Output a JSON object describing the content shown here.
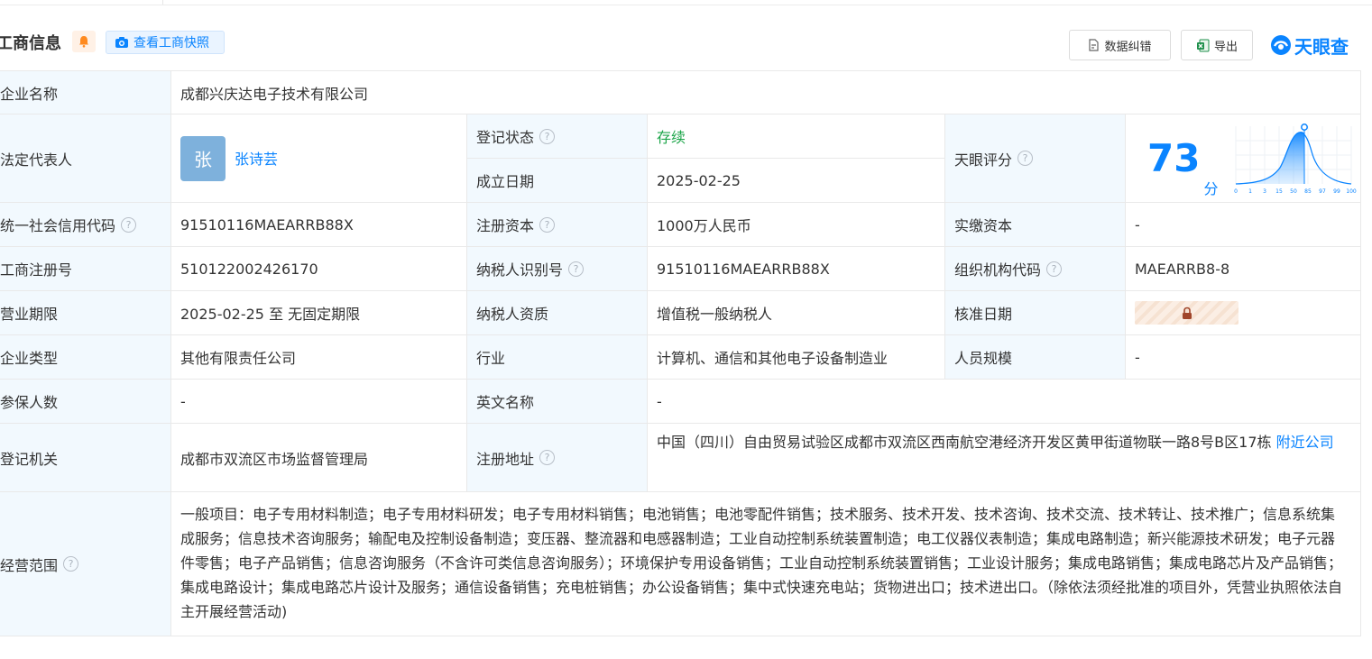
{
  "header": {
    "title": "工商信息",
    "snapshot_label": "查看工商快照",
    "correct_label": "数据纠错",
    "export_label": "导出",
    "logo_text": "天眼查"
  },
  "company": {
    "name_label": "企业名称",
    "name": "成都兴庆达电子技术有限公司",
    "legal_rep_label": "法定代表人",
    "avatar_char": "张",
    "legal_rep": "张诗芸",
    "status_label": "登记状态",
    "status": "存续",
    "founded_label": "成立日期",
    "founded": "2025-02-25",
    "score_label": "天眼评分",
    "score": "73",
    "score_unit": "分",
    "score_axis": [
      "0",
      "1",
      "3",
      "15",
      "50",
      "85",
      "97",
      "99",
      "100"
    ],
    "credit_code_label": "统一社会信用代码",
    "credit_code": "91510116MAEARRB88X",
    "reg_capital_label": "注册资本",
    "reg_capital": "1000万人民币",
    "paid_capital_label": "实缴资本",
    "paid_capital": "-",
    "reg_no_label": "工商注册号",
    "reg_no": "510122002426170",
    "taxpayer_id_label": "纳税人识别号",
    "taxpayer_id": "91510116MAEARRB88X",
    "org_code_label": "组织机构代码",
    "org_code": "MAEARRB8-8",
    "term_label": "营业期限",
    "term": "2025-02-25 至 无固定期限",
    "taxpayer_qual_label": "纳税人资质",
    "taxpayer_qual": "增值税一般纳税人",
    "approve_date_label": "核准日期",
    "type_label": "企业类型",
    "type": "其他有限责任公司",
    "industry_label": "行业",
    "industry": "计算机、通信和其他电子设备制造业",
    "staff_label": "人员规模",
    "staff": "-",
    "insured_label": "参保人数",
    "insured": "-",
    "english_label": "英文名称",
    "english": "-",
    "authority_label": "登记机关",
    "authority": "成都市双流区市场监督管理局",
    "address_label": "注册地址",
    "address": "中国（四川）自由贸易试验区成都市双流区西南航空港经济开发区黄甲街道物联一路8号B区17栋",
    "nearby_link": "附近公司",
    "scope_label": "经营范围",
    "scope": "一般项目：电子专用材料制造；电子专用材料研发；电子专用材料销售；电池销售；电池零配件销售；技术服务、技术开发、技术咨询、技术交流、技术转让、技术推广；信息系统集成服务；信息技术咨询服务；输配电及控制设备制造；变压器、整流器和电感器制造；工业自动控制系统装置制造；电工仪器仪表制造；集成电路制造；新兴能源技术研发；电子元器件零售；电子产品销售；信息咨询服务（不含许可类信息咨询服务）；环境保护专用设备销售；工业自动控制系统装置销售；工业设计服务；集成电路销售；集成电路芯片及产品销售；集成电路设计；集成电路芯片设计及服务；通信设备销售；充电桩销售；办公设备销售；集中式快速充电站；货物进出口；技术进出口。（除依法须经批准的项目外，凭营业执照依法自主开展经营活动)"
  },
  "colors": {
    "accent": "#0a84ff",
    "label_bg": "#f2f9fe",
    "status_green": "#1da54a"
  }
}
